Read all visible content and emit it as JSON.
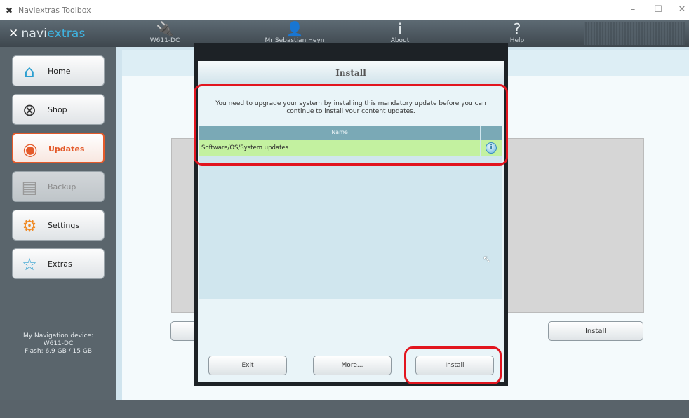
{
  "window": {
    "title": "Naviextras Toolbox",
    "minimize": "–",
    "maximize": "☐",
    "close": "✕"
  },
  "header": {
    "logo_navi": "navi",
    "logo_extras": "extras",
    "items": [
      {
        "label": "W611-DC",
        "icon": "plug-icon"
      },
      {
        "label": "Mr Sebastian Heyn",
        "icon": "user-icon"
      },
      {
        "label": "About",
        "icon": "info-icon"
      },
      {
        "label": "Help",
        "icon": "question-icon"
      }
    ]
  },
  "sidebar": {
    "items": [
      {
        "label": "Home",
        "icon": "house-icon",
        "state": "normal"
      },
      {
        "label": "Shop",
        "icon": "cart-icon",
        "state": "normal"
      },
      {
        "label": "Updates",
        "icon": "globe-icon",
        "state": "active"
      },
      {
        "label": "Backup",
        "icon": "backup-icon",
        "state": "disabled"
      },
      {
        "label": "Settings",
        "icon": "gear-icon",
        "state": "normal"
      },
      {
        "label": "Extras",
        "icon": "star-icon",
        "state": "normal"
      }
    ],
    "device_line1": "My Navigation device:",
    "device_line2": "W611-DC",
    "device_line3": "Flash: 6.9 GB / 15 GB"
  },
  "background": {
    "install_label": "Install"
  },
  "modal": {
    "title": "Install",
    "message_line1": "You need to upgrade your system by installing this mandatory update before you can",
    "message_line2": "continue to install your content updates.",
    "table": {
      "header_name": "Name",
      "rows": [
        {
          "name": "Software/OS/System updates",
          "info": "i"
        }
      ]
    },
    "buttons": {
      "exit": "Exit",
      "more": "More...",
      "install": "Install"
    }
  },
  "colors": {
    "accent": "#e45a2a",
    "highlight": "#e2151f",
    "row_green": "#c3f1a0",
    "header_teal": "#7aa9b6"
  }
}
